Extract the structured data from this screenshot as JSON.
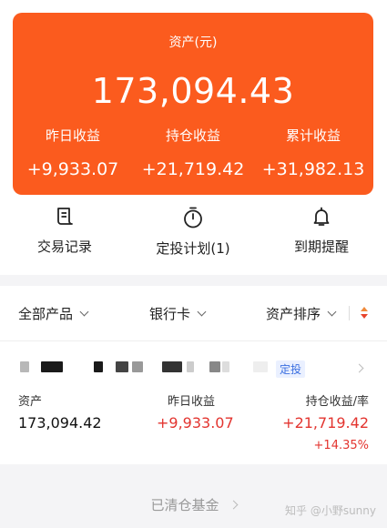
{
  "summary": {
    "label": "资产(元)",
    "total": "173,094.43",
    "stats": [
      {
        "label": "昨日收益",
        "value": "+9,933.07"
      },
      {
        "label": "持仓收益",
        "value": "+21,719.42"
      },
      {
        "label": "累计收益",
        "value": "+31,982.13"
      }
    ]
  },
  "actions": [
    {
      "label": "交易记录",
      "icon": "receipt-icon"
    },
    {
      "label": "定投计划(1)",
      "icon": "timer-icon"
    },
    {
      "label": "到期提醒",
      "icon": "bell-icon"
    }
  ],
  "filters": {
    "all_products": "全部产品",
    "bank_card": "银行卡",
    "asset_sort": "资产排序"
  },
  "fund": {
    "tag": "定投",
    "col_asset": "资产",
    "col_yesterday": "昨日收益",
    "col_holding": "持仓收益/率",
    "asset_value": "173,094.42",
    "yesterday_value": "+9,933.07",
    "holding_value": "+21,719.42",
    "holding_rate": "+14.35%"
  },
  "footer": {
    "cleared_funds": "已清仓基金",
    "watermark": "知乎 @小野sunny"
  },
  "colors": {
    "brand_orange": "#fb5b1e",
    "gain_red": "#e3342f",
    "tag_blue": "#3b6fe0"
  }
}
